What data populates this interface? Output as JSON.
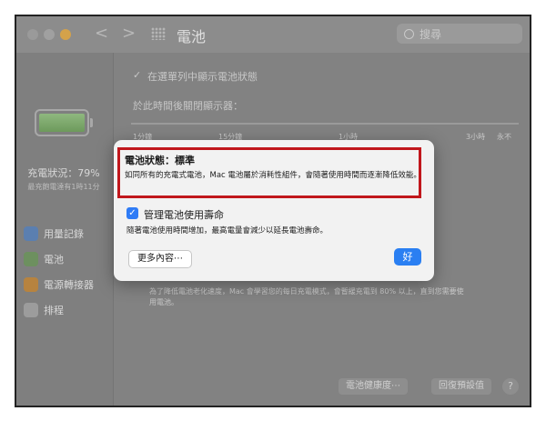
{
  "window": {
    "title": "電池",
    "nav_back": "<",
    "nav_forward": ">",
    "search_placeholder": "搜尋"
  },
  "sidebar": {
    "charge_status": "充電狀況：79%",
    "charge_note": "最充飽電達有1時11分",
    "items": [
      {
        "label": "用量記錄",
        "icon": "usage-history-icon",
        "color": "#5b8fd6"
      },
      {
        "label": "電池",
        "icon": "battery-icon",
        "color": "#6fa05f"
      },
      {
        "label": "電源轉接器",
        "icon": "power-adapter-icon",
        "color": "#d28f3c"
      },
      {
        "label": "排程",
        "icon": "schedule-icon",
        "color": "#a9a9a9"
      }
    ]
  },
  "main": {
    "show_status_checkbox": "✓",
    "show_status_label": "在選單列中顯示電池狀態",
    "display_off_label": "於此時間後關閉顯示器：",
    "ticks": [
      "1分鐘",
      "15分鐘",
      "1小時",
      "3小時",
      "永不"
    ],
    "bg_note_line1": "為了降低電池老化速度，Mac 會學習您的每日充電模式，會暫緩充電到 80% 以上，直到您需要使",
    "bg_note_line2": "用電池。",
    "battery_health_button": "電池健康度⋯",
    "restore_defaults_button": "回復預設值",
    "help_button": "?"
  },
  "dialog": {
    "title": "電池狀態：標準",
    "description": "如同所有的充電式電池，Mac 電池屬於消耗性組件，會隨著使用時間而逐漸降低效能。",
    "checkbox_mark": "✓",
    "checkbox_label": "管理電池使用壽命",
    "checkbox_description": "隨著電池使用時間增加，最高電量會減少以延長電池壽命。",
    "more_info_button": "更多內容⋯",
    "ok_button": "好",
    "colors": {
      "accent": "#2a7ff2",
      "highlight": "#c1171c"
    }
  }
}
